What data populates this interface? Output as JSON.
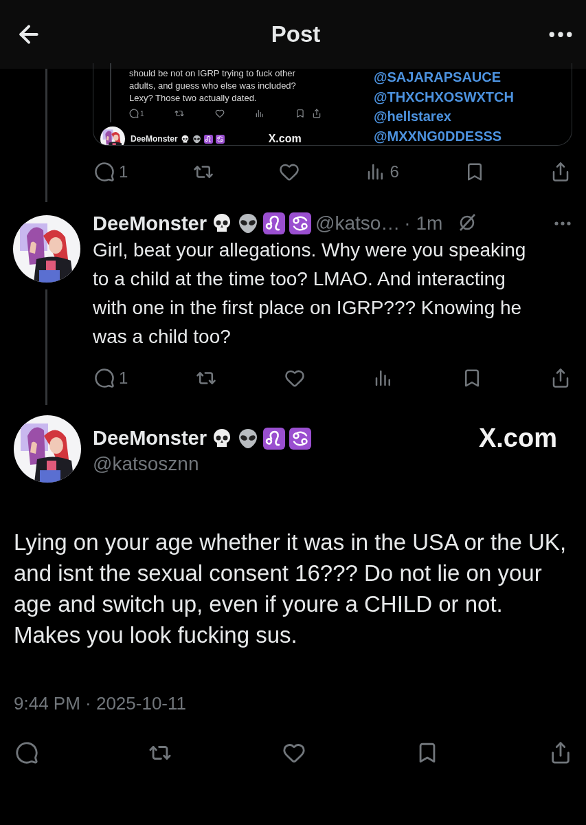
{
  "header": {
    "title": "Post"
  },
  "quoted_card": {
    "text": "should be not on IGRP trying to fuck other adults, and guess who else was included? Lexy? Those two actually dated.",
    "reply_count": "1",
    "author": "DeeMonster",
    "site": "X.com",
    "handles": [
      "@SAJARAPSAUCE",
      "@THXCHXOSWXTCH",
      "@hellstarex",
      "@MXXNG0DDESSS"
    ]
  },
  "quoted_actions": [
    {
      "kind": "reply",
      "count": "1"
    },
    {
      "kind": "repost"
    },
    {
      "kind": "like"
    },
    {
      "kind": "views",
      "count": "6"
    },
    {
      "kind": "bookmark"
    },
    {
      "kind": "share"
    }
  ],
  "reply": {
    "name": "DeeMonster",
    "handle": "@katso…",
    "time": "· 1m",
    "text": "Girl, beat your allegations. Why were you speaking to a child at the time too? LMAO. And interacting with one in the first place on IGRP??? Knowing he was a child too?",
    "actions": [
      {
        "kind": "reply",
        "count": "1"
      },
      {
        "kind": "repost"
      },
      {
        "kind": "like"
      },
      {
        "kind": "views"
      },
      {
        "kind": "bookmark"
      },
      {
        "kind": "share"
      }
    ]
  },
  "main_post": {
    "name": "DeeMonster",
    "handle": "@katsosznn",
    "site": "X.com",
    "text": "Lying on your age whether it was in the USA or the UK, and isnt the sexual consent 16??? Do not lie on your age and switch up, even if youre a CHILD or not. Makes you look fucking sus.",
    "timestamp": "9:44 PM · 2025-10-11",
    "actions": [
      {
        "kind": "reply"
      },
      {
        "kind": "repost"
      },
      {
        "kind": "like"
      },
      {
        "kind": "bookmark"
      },
      {
        "kind": "share"
      }
    ]
  }
}
